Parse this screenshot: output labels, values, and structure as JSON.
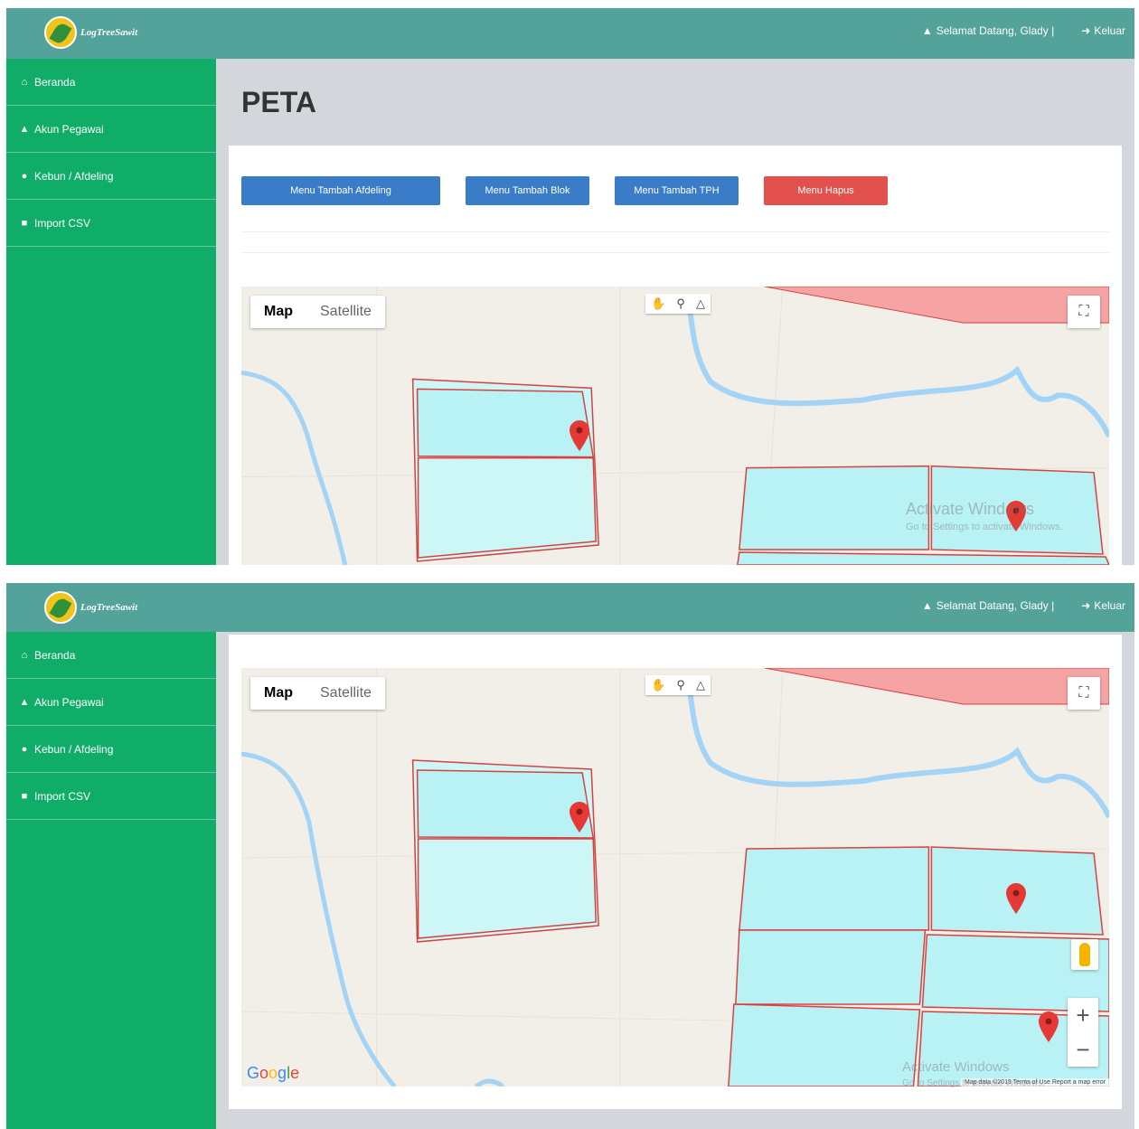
{
  "app": {
    "logo_text": "LogTreeSawit",
    "welcome": "Selamat Datang, Glady |",
    "logout": "Keluar"
  },
  "sidebar": {
    "items": [
      {
        "label": "Beranda",
        "icon": "home-icon"
      },
      {
        "label": "Akun Pegawai",
        "icon": "user-icon"
      },
      {
        "label": "Kebun / Afdeling",
        "icon": "map-marker-icon"
      },
      {
        "label": "Import CSV",
        "icon": "table-icon"
      }
    ]
  },
  "page": {
    "title": "PETA"
  },
  "toolbar": {
    "add_afdeling": "Menu Tambah Afdeling",
    "add_blok": "Menu Tambah Blok",
    "add_tph": "Menu Tambah TPH",
    "delete": "Menu Hapus"
  },
  "map": {
    "type_map": "Map",
    "type_satellite": "Satellite",
    "zoom_in": "+",
    "zoom_out": "−",
    "google": "Google",
    "attribution": "Map data ©2019   Terms of Use   Report a map error"
  },
  "watermark": {
    "line1": "Activate Windows",
    "line2": "Go to Settings to activate Windows."
  },
  "colors": {
    "topbar": "#54a39b",
    "sidebar": "#0fad68",
    "btn_primary": "#3b7cc9",
    "btn_danger": "#e2514d",
    "block_fill": "#b8f2f4",
    "block_border": "#d9413f"
  }
}
